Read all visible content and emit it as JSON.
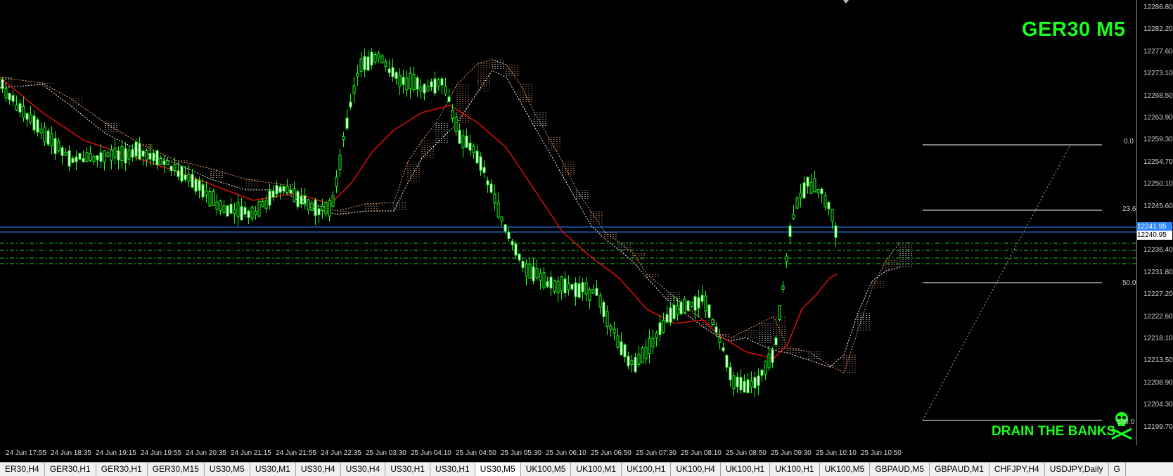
{
  "chart": {
    "symbol_title": "GER30 M5",
    "watermark": "DRAIN THE BANKS",
    "colors": {
      "background": "#000000",
      "bull_candle": "#ffffff",
      "bear_candle": "#000000",
      "candle_wick": "#19ff19",
      "moving_average": "#ff1010",
      "ichimoku_cloud": "#f0a070",
      "ichimoku_cloud_alt": "#ffffff",
      "horizontal_blue": "#2a86ff",
      "horizontal_green_dash": "#1fcc1f",
      "fibonacci": "#ffffff",
      "trend_dotted": "#b2b25a",
      "accent_green": "#19ff19"
    }
  },
  "price_scale": {
    "labels": [
      "12286.80",
      "12282.20",
      "12277.60",
      "12273.10",
      "12268.50",
      "12263.90",
      "12259.30",
      "12254.70",
      "12250.10",
      "12245.60",
      "12241.00",
      "12236.40",
      "12231.80",
      "12227.20",
      "12222.60",
      "12218.10",
      "12213.50",
      "12208.90",
      "12204.30",
      "12199.70"
    ],
    "current_price": "12240.95",
    "current_price_blue": "12241.95"
  },
  "time_axis": {
    "labels": [
      "24 Jun 17:55",
      "24 Jun 18:35",
      "24 Jun 19:15",
      "24 Jun 19:55",
      "24 Jun 20:35",
      "24 Jun 21:15",
      "24 Jun 21:55",
      "24 Jun 22:35",
      "25 Jun 03:30",
      "25 Jun 04:10",
      "25 Jun 04:50",
      "25 Jun 05:30",
      "25 Jun 06:10",
      "25 Jun 06:50",
      "25 Jun 07:30",
      "25 Jun 08:10",
      "25 Jun 08:50",
      "25 Jun 09:30",
      "25 Jun 10:10",
      "25 Jun 10:50"
    ]
  },
  "fibonacci": {
    "levels": [
      "0.0",
      "23.6",
      "50.0",
      "100.0"
    ]
  },
  "tabs": [
    "ER30,H4",
    "GER30,H1",
    "GER30,H1",
    "GER30,M15",
    "US30,M5",
    "US30,M1",
    "US30,H4",
    "US30,H4",
    "US30,H1",
    "US30,H1",
    "US30,M5",
    "UK100,M5",
    "UK100,M1",
    "UK100,H1",
    "UK100,H4",
    "UK100,H1",
    "UK100,H1",
    "UK100,M5",
    "GBPAUD,M5",
    "GBPAUD,M1",
    "CHFJPY,H4",
    "USDJPY,Daily",
    "G"
  ],
  "active_tab_index": 10
}
